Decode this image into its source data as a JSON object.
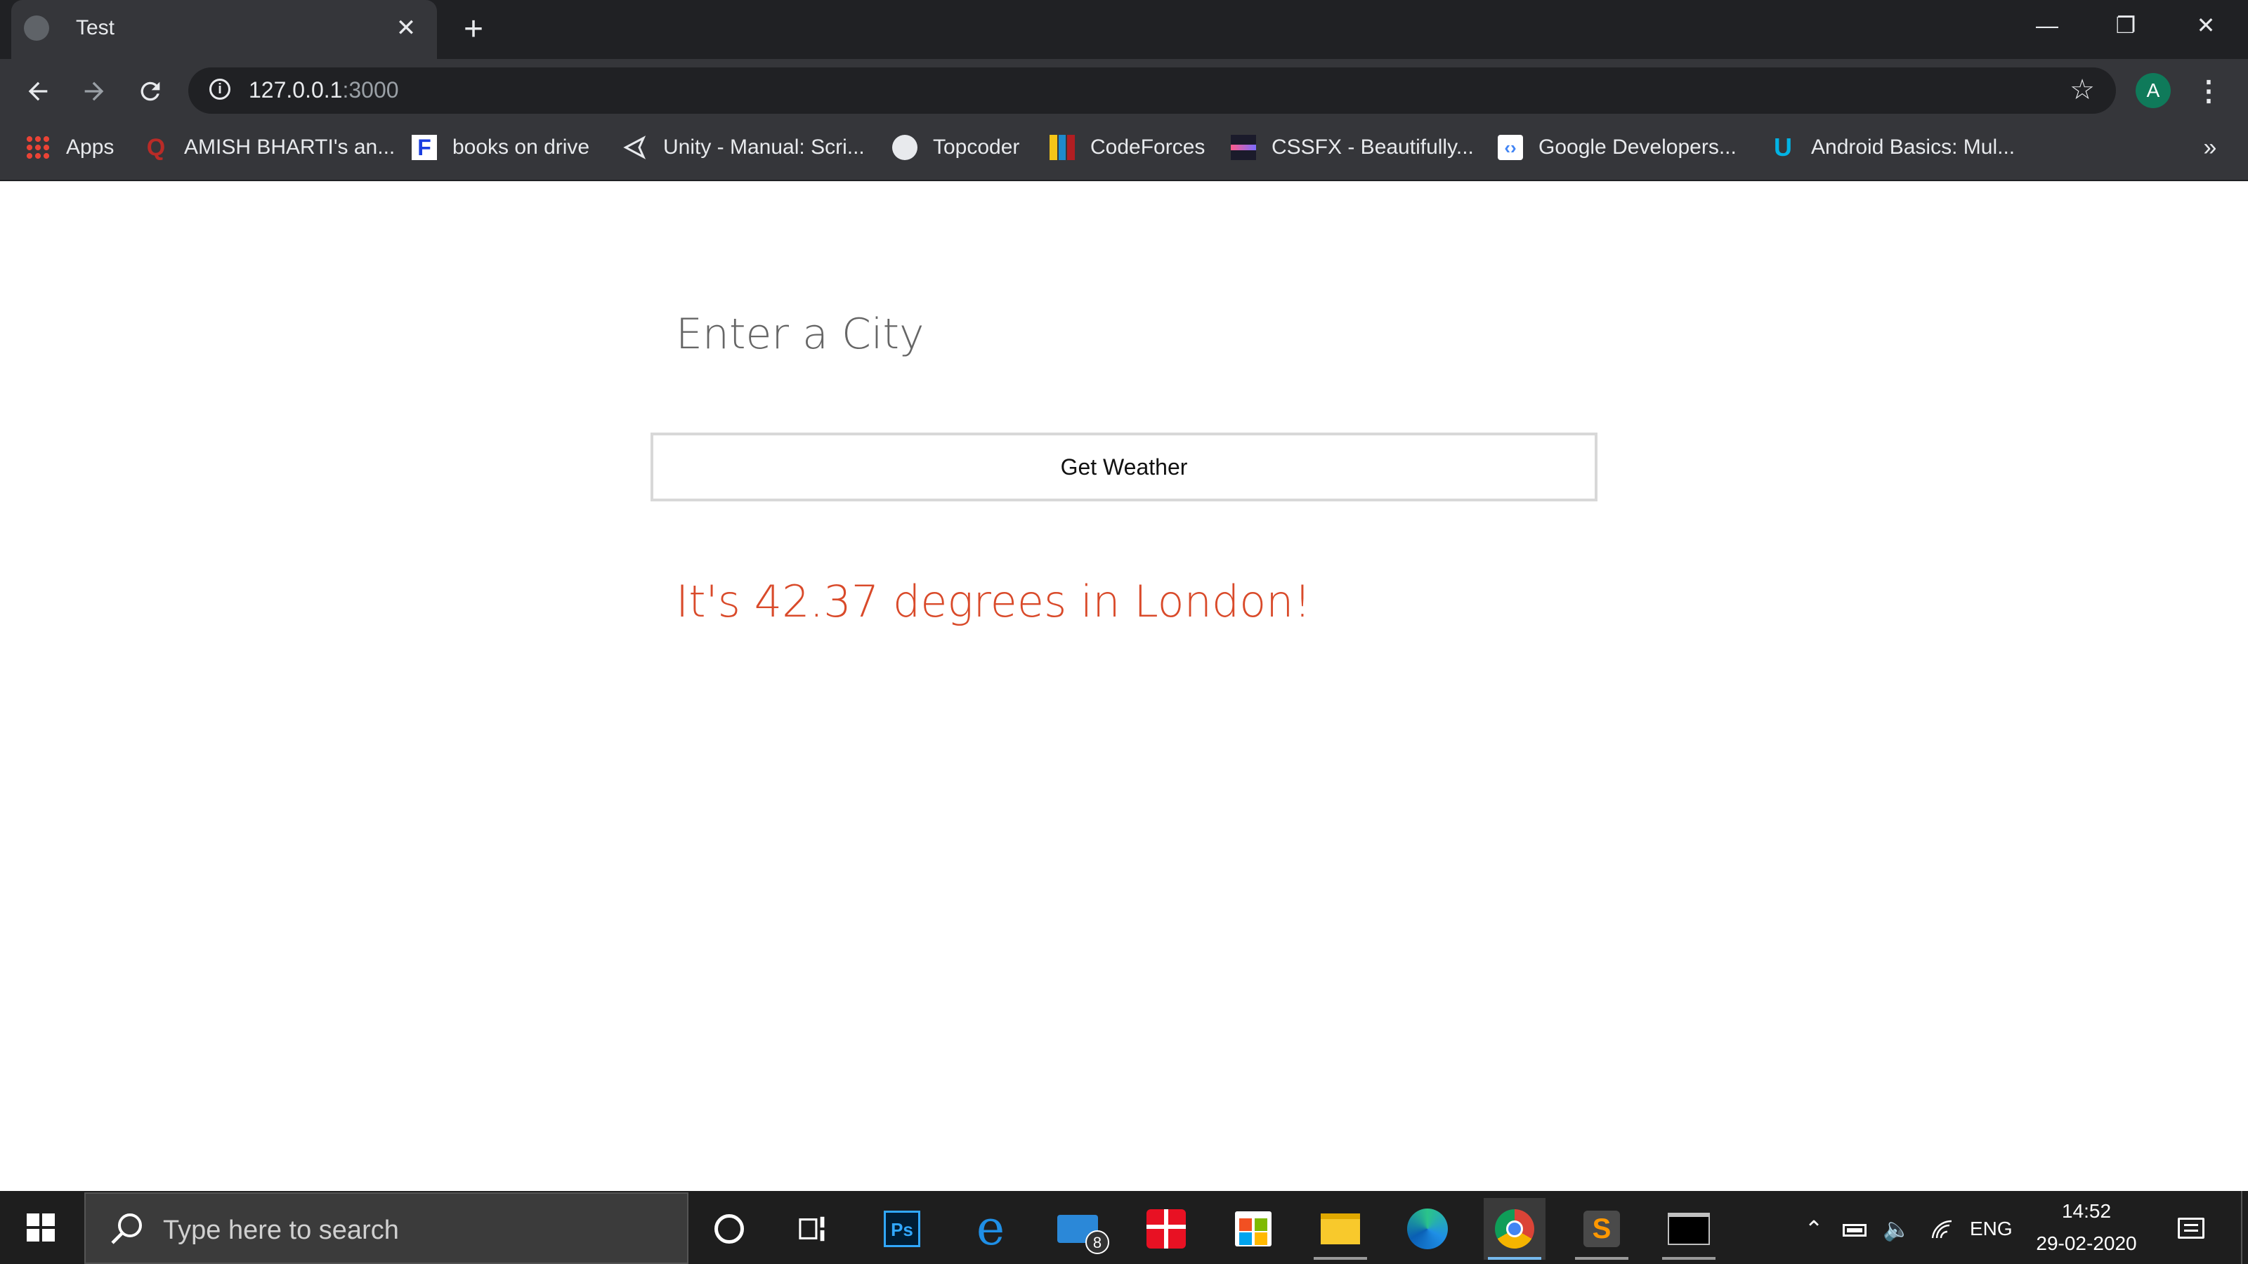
{
  "browser": {
    "tab_title": "Test",
    "close_tab_label": "✕",
    "new_tab_label": "+",
    "window_controls": {
      "minimize": "—",
      "restore": "❐",
      "close": "✕"
    },
    "url_host": "127.0.0.1",
    "url_port": ":3000",
    "avatar_letter": "A",
    "bookmarks": [
      {
        "label": "Apps",
        "icon": "apps-grid-icon"
      },
      {
        "label": "AMISH BHARTI's an...",
        "icon": "quora-icon"
      },
      {
        "label": "books on drive",
        "icon": "f-icon"
      },
      {
        "label": "Unity - Manual: Scri...",
        "icon": "unity-icon"
      },
      {
        "label": "Topcoder",
        "icon": "globe-icon"
      },
      {
        "label": "CodeForces",
        "icon": "codeforces-icon"
      },
      {
        "label": "CSSFX - Beautifully...",
        "icon": "cssfx-icon"
      },
      {
        "label": "Google Developers...",
        "icon": "google-developers-icon"
      },
      {
        "label": "Android Basics: Mul...",
        "icon": "udacity-icon"
      }
    ],
    "overflow_label": "»"
  },
  "page": {
    "city_placeholder": "Enter a City",
    "button_label": "Get Weather",
    "result_text": "It's 42.37 degrees in London!"
  },
  "taskbar": {
    "search_placeholder": "Type here to search",
    "mail_badge": "8",
    "time": "14:52",
    "date": "29-02-2020",
    "language": "ENG"
  },
  "colors": {
    "result": "#d94a2a",
    "chrome_dark": "#202124",
    "chrome_toolbar": "#35363a"
  }
}
